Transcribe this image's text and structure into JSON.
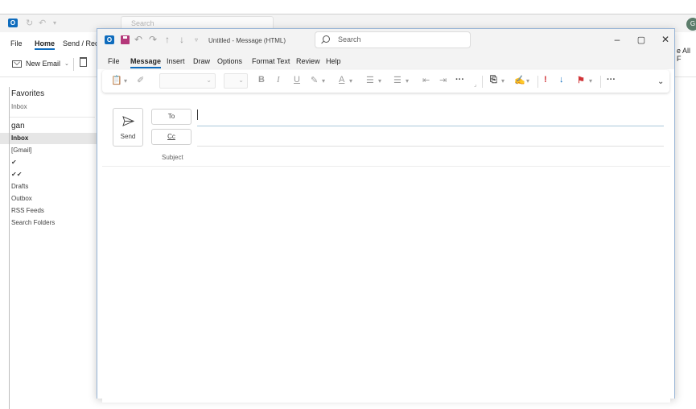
{
  "background_window": {
    "search_placeholder": "Search",
    "avatar_initial": "G",
    "tabs": [
      "File",
      "Home",
      "Send / Rece"
    ],
    "active_tab": "Home",
    "new_email_label": "New Email",
    "right_edge_text": "e All F",
    "favorites": {
      "title": "Favorites",
      "items": [
        "Inbox"
      ]
    },
    "account": {
      "name": "gan",
      "folders": [
        {
          "label": "Inbox",
          "selected": true
        },
        {
          "label": "[Gmail]",
          "selected": false
        },
        {
          "label": "✔",
          "selected": false
        },
        {
          "label": "✔✔",
          "selected": false
        },
        {
          "label": "Drafts",
          "selected": false
        },
        {
          "label": "Outbox",
          "selected": false
        },
        {
          "label": "RSS Feeds",
          "selected": false
        },
        {
          "label": "Search Folders",
          "selected": false
        }
      ]
    }
  },
  "compose": {
    "title": "Untitled - Message (HTML)",
    "search_placeholder": "Search",
    "menu": [
      "File",
      "Message",
      "Insert",
      "Draw",
      "Options",
      "Format Text",
      "Review",
      "Help"
    ],
    "active_menu": "Message",
    "send_label": "Send",
    "to_label": "To",
    "cc_label": "Cc",
    "subject_label": "Subject",
    "to_value": "",
    "cc_value": "",
    "subject_value": ""
  },
  "colors": {
    "accent": "#0f6cbd",
    "flag": "#d13438",
    "save": "#b4387a"
  }
}
